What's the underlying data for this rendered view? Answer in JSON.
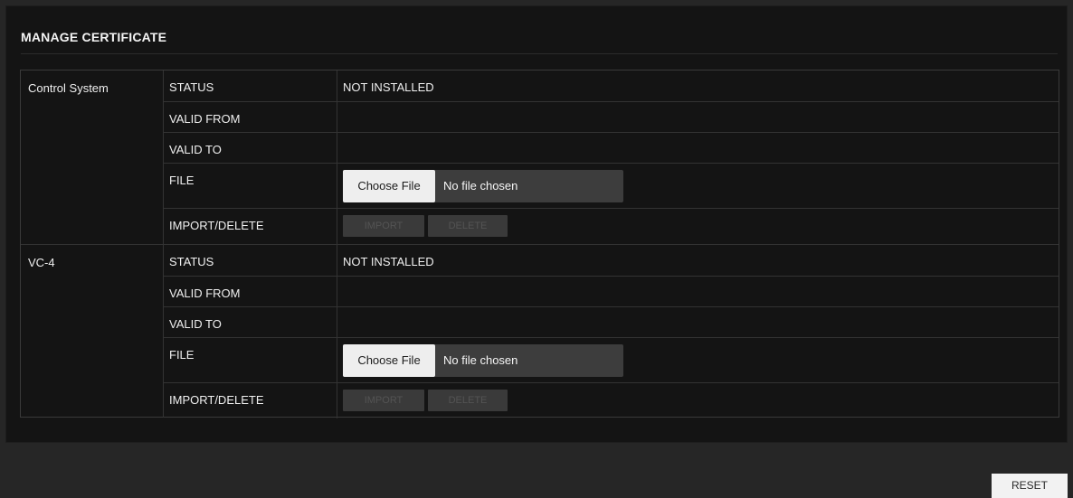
{
  "title": "MANAGE CERTIFICATE",
  "groups": [
    {
      "name": "Control System",
      "rows": {
        "status_label": "STATUS",
        "status_value": "NOT INSTALLED",
        "valid_from_label": "VALID FROM",
        "valid_from_value": "",
        "valid_to_label": "VALID TO",
        "valid_to_value": "",
        "file_label": "FILE",
        "choose_file_label": "Choose File",
        "file_value": "No file chosen",
        "import_delete_label": "IMPORT/DELETE",
        "import_label": "IMPORT",
        "delete_label": "DELETE"
      }
    },
    {
      "name": "VC-4",
      "rows": {
        "status_label": "STATUS",
        "status_value": "NOT INSTALLED",
        "valid_from_label": "VALID FROM",
        "valid_from_value": "",
        "valid_to_label": "VALID TO",
        "valid_to_value": "",
        "file_label": "FILE",
        "choose_file_label": "Choose File",
        "file_value": "No file chosen",
        "import_delete_label": "IMPORT/DELETE",
        "import_label": "IMPORT",
        "delete_label": "DELETE"
      }
    }
  ],
  "footer": {
    "reset_label": "RESET"
  },
  "colors": {
    "background": "#262626",
    "panel": "#141414",
    "button_light": "#eeeeee",
    "button_disabled": "#3a3a3a"
  }
}
